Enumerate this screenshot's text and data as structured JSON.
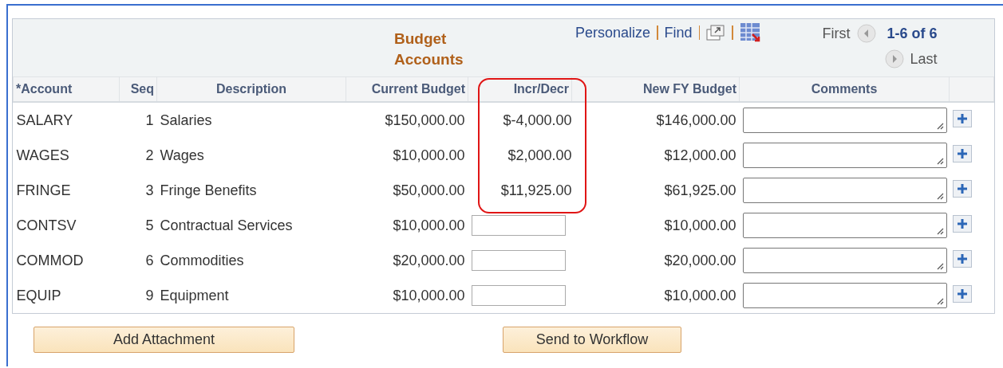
{
  "grid": {
    "title": "Budget Accounts",
    "links": [
      "Personalize",
      "Find"
    ],
    "nav": {
      "first": "First",
      "range": "1-6 of 6",
      "last": "Last"
    }
  },
  "columns": [
    {
      "label": "*Account"
    },
    {
      "label": "Seq"
    },
    {
      "label": "Description"
    },
    {
      "label": "Current Budget"
    },
    {
      "label": "Incr/Decr"
    },
    {
      "label": "New FY Budget"
    },
    {
      "label": "Comments"
    }
  ],
  "rows": [
    {
      "account": "SALARY",
      "seq": "1",
      "description": "Salaries",
      "current": "$150,000.00",
      "incr": {
        "kind": "text",
        "value": "$-4,000.00"
      },
      "new_budget": "$146,000.00",
      "highlighted": true
    },
    {
      "account": "WAGES",
      "seq": "2",
      "description": "Wages",
      "current": "$10,000.00",
      "incr": {
        "kind": "text",
        "value": "$2,000.00"
      },
      "new_budget": "$12,000.00",
      "highlighted": true
    },
    {
      "account": "FRINGE",
      "seq": "3",
      "description": "Fringe Benefits",
      "current": "$50,000.00",
      "incr": {
        "kind": "text",
        "value": "$11,925.00"
      },
      "new_budget": "$61,925.00",
      "highlighted": true
    },
    {
      "account": "CONTSV",
      "seq": "5",
      "description": "Contractual Services",
      "current": "$10,000.00",
      "incr": {
        "kind": "input"
      },
      "new_budget": "$10,000.00",
      "highlighted": false
    },
    {
      "account": "COMMOD",
      "seq": "6",
      "description": "Commodities",
      "current": "$20,000.00",
      "incr": {
        "kind": "input"
      },
      "new_budget": "$20,000.00",
      "highlighted": false
    },
    {
      "account": "EQUIP",
      "seq": "9",
      "description": "Equipment",
      "current": "$10,000.00",
      "incr": {
        "kind": "input"
      },
      "new_budget": "$10,000.00",
      "highlighted": false
    }
  ],
  "buttons": [
    "Add Attachment",
    "Send to Workflow"
  ]
}
